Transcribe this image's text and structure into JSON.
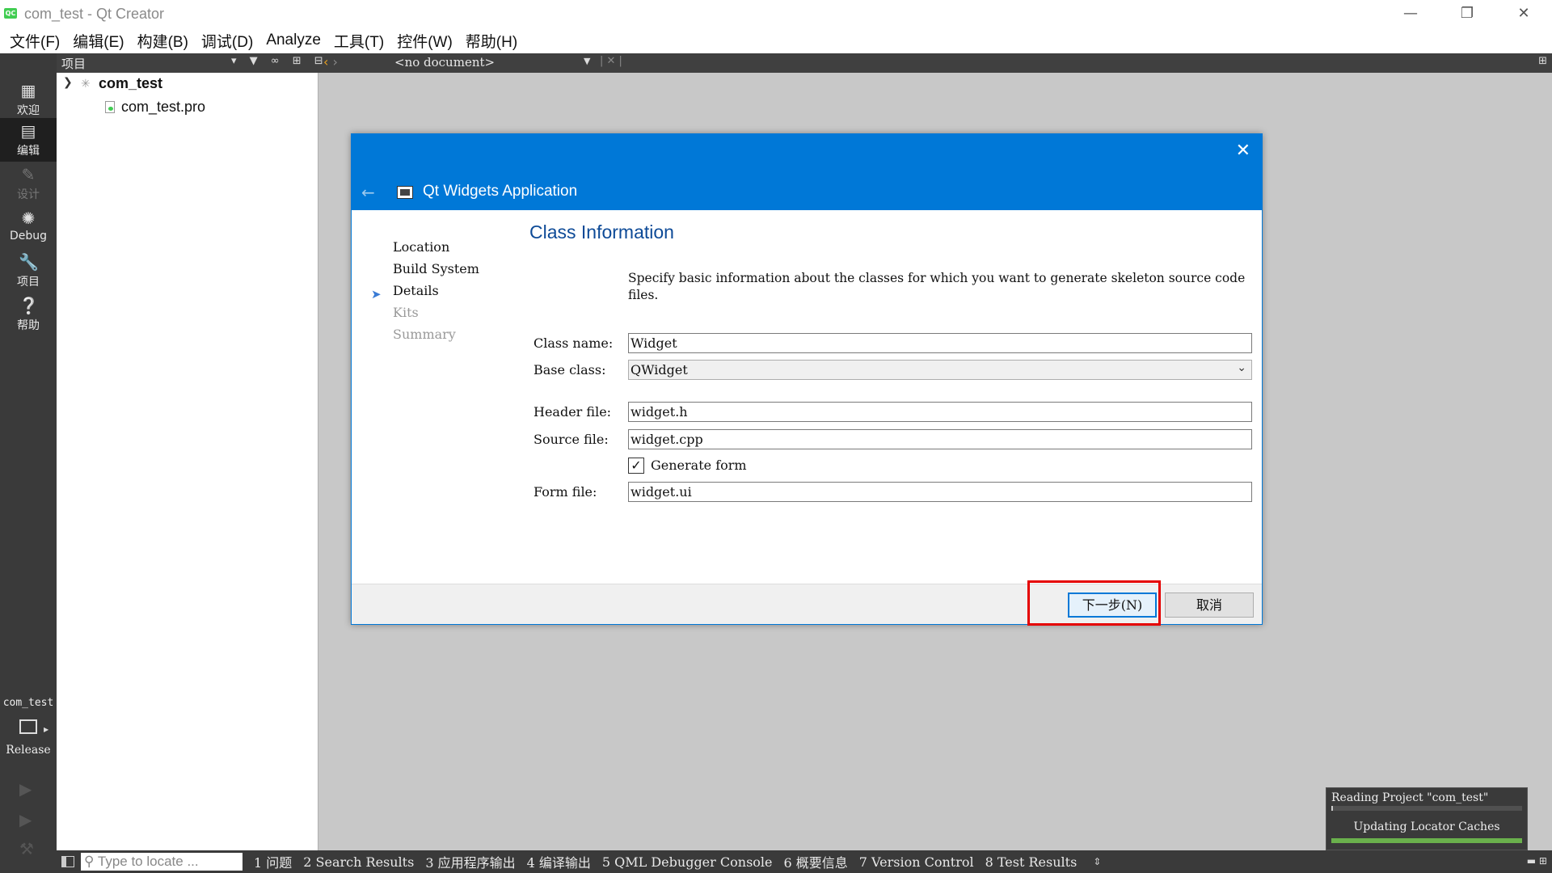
{
  "window": {
    "app_icon": "QC",
    "title": "com_test - Qt Creator",
    "minimize_icon": "minimize-icon",
    "restore_icon": "restore-icon",
    "close_icon": "close-icon"
  },
  "menu": [
    "文件(F)",
    "编辑(E)",
    "构建(B)",
    "调试(D)",
    "Analyze",
    "工具(T)",
    "控件(W)",
    "帮助(H)"
  ],
  "modes": [
    {
      "label": "欢迎",
      "icon": "grid-icon"
    },
    {
      "label": "编辑",
      "icon": "edit-icon"
    },
    {
      "label": "设计",
      "icon": "pencil-icon"
    },
    {
      "label": "Debug",
      "icon": "bug-icon"
    },
    {
      "label": "项目",
      "icon": "wrench-icon"
    },
    {
      "label": "帮助",
      "icon": "help-icon"
    }
  ],
  "toolstrip": {
    "projects_label": "项目",
    "document": "<no document>"
  },
  "tree": {
    "project": "com_test",
    "file": "com_test.pro"
  },
  "dialog": {
    "title": "Qt Widgets Application",
    "steps": [
      "Location",
      "Build System",
      "Details",
      "Kits",
      "Summary"
    ],
    "current_step": "Details",
    "page_title": "Class Information",
    "description": "Specify basic information about the classes for which you want to generate skeleton source code files.",
    "fields": {
      "class_name": {
        "label": "Class name:",
        "value": "Widget"
      },
      "base_class": {
        "label": "Base class:",
        "value": "QWidget"
      },
      "header_file": {
        "label": "Header file:",
        "value": "widget.h"
      },
      "source_file": {
        "label": "Source file:",
        "value": "widget.cpp"
      },
      "generate_form": {
        "label": "Generate form",
        "checked": true
      },
      "form_file": {
        "label": "Form file:",
        "value": "widget.ui"
      }
    },
    "next_button": "下一步(N)",
    "cancel_button": "取消"
  },
  "target": {
    "project": "com_test",
    "config": "Release"
  },
  "locator": {
    "placeholder": "Type to locate ..."
  },
  "output_tabs": [
    "1 问题",
    "2 Search Results",
    "3 应用程序输出",
    "4 编译输出",
    "5 QML Debugger Console",
    "6 概要信息",
    "7 Version Control",
    "8 Test Results"
  ],
  "progress": {
    "task1": "Reading Project \"com_test\"",
    "task1_progress": 0.01,
    "task2": "Updating Locator Caches",
    "task2_progress": 1.0
  }
}
